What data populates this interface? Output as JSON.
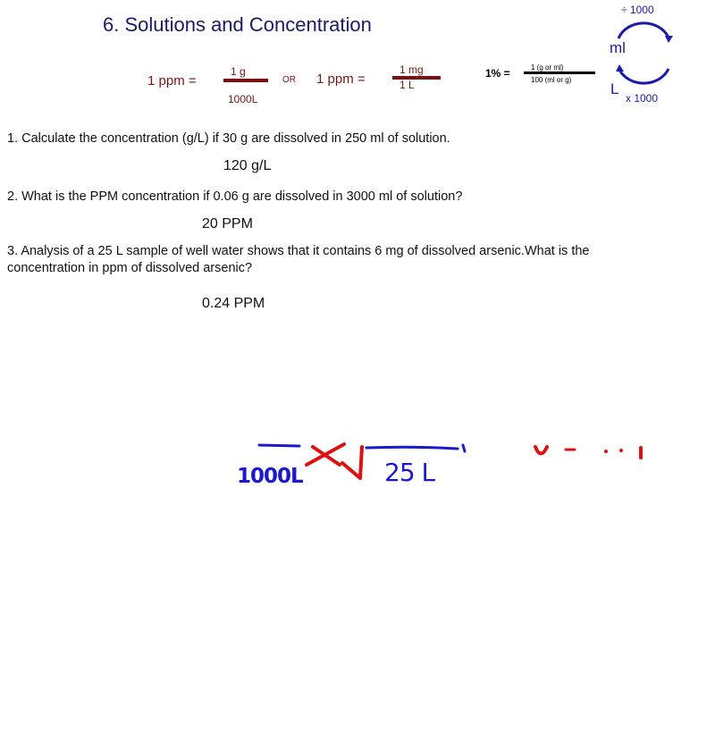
{
  "title": "6. Solutions and Concentration",
  "formulas": {
    "ppm1": {
      "label": "1 ppm =",
      "numerator": "1 g",
      "denominator": "1000L"
    },
    "or_label": "OR",
    "ppm2": {
      "label": "1 ppm =",
      "numerator": "1 mg",
      "denominator": "1 L"
    },
    "percent": {
      "label": "1% =",
      "numerator": "1 (g or ml)",
      "denominator": "100 (ml or g)"
    }
  },
  "conversion": {
    "divide_label": "÷ 1000",
    "unit_top": "ml",
    "unit_bottom": "L",
    "multiply_label": "x 1000"
  },
  "questions": [
    {
      "text": "1. Calculate the concentration (g/L) if 30 g are dissolved in 250 ml of solution.",
      "answer": "120 g/L"
    },
    {
      "text": "2. What is the PPM concentration if 0.06 g are dissolved in 3000 ml of solution?",
      "answer": "20 PPM"
    },
    {
      "text_line1": "3. Analysis of a 25 L sample of well water shows that it contains 6 mg of dissolved arsenic.What is the",
      "text_line2": "concentration in ppm of dissolved arsenic?",
      "answer": "0.24 PPM"
    }
  ],
  "handwriting": {
    "left_fraction_denominator": "1000L",
    "right_fraction_denominator": "25 L"
  },
  "colors": {
    "title": "#1a1a66",
    "ppm": "#7a1515",
    "ink_blue": "#1a1acc",
    "ink_red": "#dd1111"
  }
}
